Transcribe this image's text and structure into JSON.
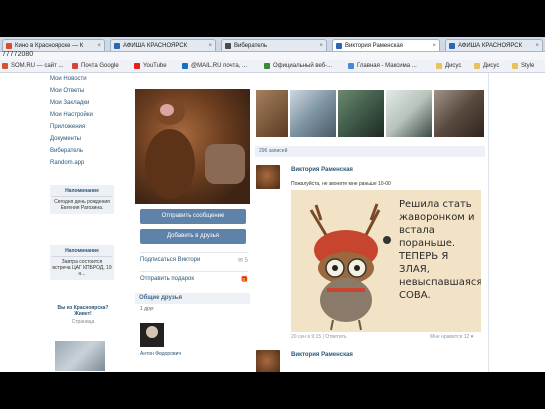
{
  "browser": {
    "tabs": [
      {
        "label": "Кино в Красноярске — К",
        "color": "#e04a2a"
      },
      {
        "label": "АФИША КРАСНОЯРСК",
        "color": "#2a67b8"
      },
      {
        "label": "Вибератель",
        "color": "#4a4a4a"
      },
      {
        "label": "Виктория Раменская",
        "color": "#2a67b8"
      },
      {
        "label": "АФИША КРАСНОЯРСК",
        "color": "#2a67b8"
      }
    ],
    "address_text": "77772080",
    "bookmarks": [
      {
        "label": "SOM.RU — сайт ...",
        "color": "#d9502a"
      },
      {
        "label": "Почта Google",
        "color": "#d44638"
      },
      {
        "label": "YouTube",
        "color": "#e62117"
      },
      {
        "label": "@MAIL.RU почта, ...",
        "color": "#1a6fc4"
      },
      {
        "label": "Официальный веб-...",
        "color": "#3a8a3a"
      },
      {
        "label": "Главная - Максима ...",
        "color": "#4a8ad4"
      },
      {
        "label": "Дисус",
        "color": "#e8c25a"
      },
      {
        "label": "Дисус",
        "color": "#e8c25a"
      },
      {
        "label": "Style",
        "color": "#e8c25a"
      }
    ]
  },
  "left_nav": [
    "Мои Новости",
    "Мои Ответы",
    "Мои Закладки",
    "Мои Настройки",
    "Приложения",
    "Документы",
    "Вибератель",
    "Random.app"
  ],
  "reminders": [
    {
      "title": "Напоминание",
      "text": "Сегодня день рождения Евгения Рагозина."
    },
    {
      "title": "Напоминание",
      "text": "Завтра состоится встреча ЦАГ КПБРОД, 19 н..."
    }
  ],
  "ad": {
    "title": "Вы из Красноярска? Живет!",
    "sub": "Страница"
  },
  "profile": {
    "btn_message": "Отправить сообщение",
    "btn_add": "Добавить в друзья",
    "rows": [
      {
        "label": "Подписаться Виктори",
        "right": "✉ 5"
      },
      {
        "label": "Отправить подарок",
        "right": "🎁"
      }
    ],
    "friends_title": "Общие друзья",
    "friends_count": "1 друг",
    "friend_name": "Антон Федорович"
  },
  "wall": {
    "count": "296 записей",
    "photos": [
      "#6e4a2e",
      "#7e94a3",
      "#3f5a49",
      "#b5c2ba",
      "#5a4a3e"
    ],
    "post1": {
      "name": "Виктория Раменская",
      "sub": "Пожалуйста, не звоните мне раньше 10-00",
      "image_text": "Решила стать жаворонком и встала пораньше. ТЕПЕРЬ Я ЗЛАЯ, невыспавшаяся СОВА.",
      "date": "20 сен в 9:15 | Ответить",
      "all": "Мне нравится 12 ♥"
    },
    "post2": {
      "name": "Виктория Раменская"
    }
  }
}
